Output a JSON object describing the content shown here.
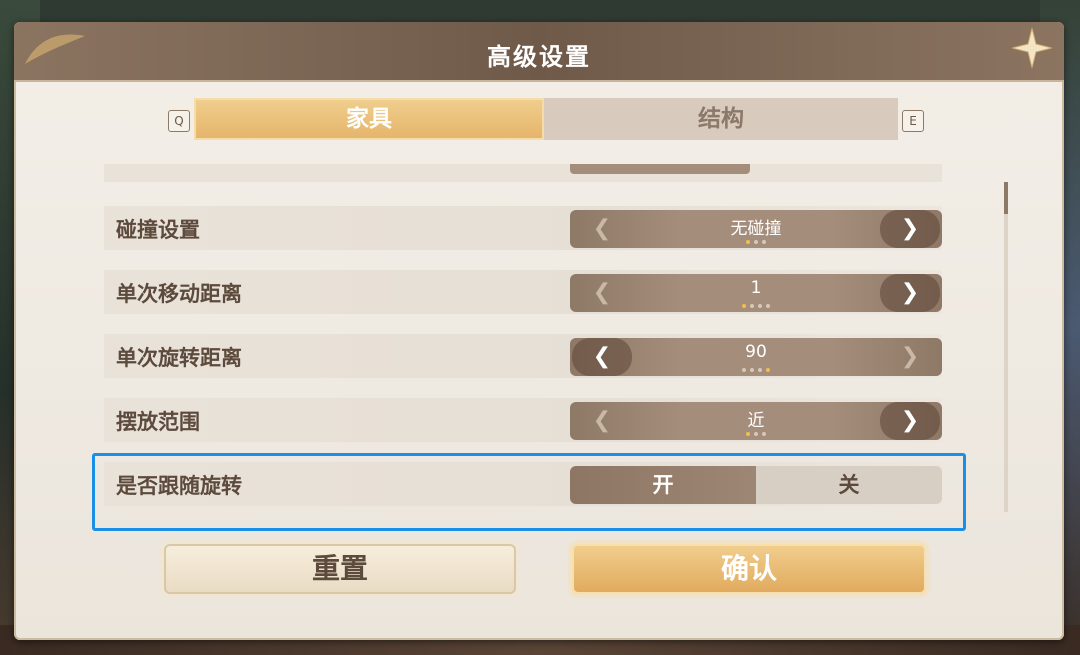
{
  "dialog": {
    "title": "高级设置"
  },
  "tabs": {
    "left_key": "Q",
    "right_key": "E",
    "items": [
      {
        "label": "家具",
        "active": true
      },
      {
        "label": "结构",
        "active": false
      }
    ]
  },
  "settings": [
    {
      "label": "碰撞设置",
      "value": "无碰撞",
      "dots_total": 3,
      "dots_active": 1,
      "prev_enabled": false,
      "next_enabled": true
    },
    {
      "label": "单次移动距离",
      "value": "1",
      "dots_total": 4,
      "dots_active": 1,
      "prev_enabled": false,
      "next_enabled": true
    },
    {
      "label": "单次旋转距离",
      "value": "90",
      "dots_total": 4,
      "dots_active": 4,
      "prev_enabled": true,
      "next_enabled": false
    },
    {
      "label": "摆放范围",
      "value": "近",
      "dots_total": 3,
      "dots_active": 1,
      "prev_enabled": false,
      "next_enabled": true
    }
  ],
  "follow_rotation": {
    "label": "是否跟随旋转",
    "on_label": "开",
    "off_label": "关",
    "selected": "开"
  },
  "buttons": {
    "reset": "重置",
    "confirm": "确认"
  },
  "colors": {
    "highlight": "#1a8fe8",
    "accent_gold": "#e5b46a",
    "header": "#7a6453"
  }
}
